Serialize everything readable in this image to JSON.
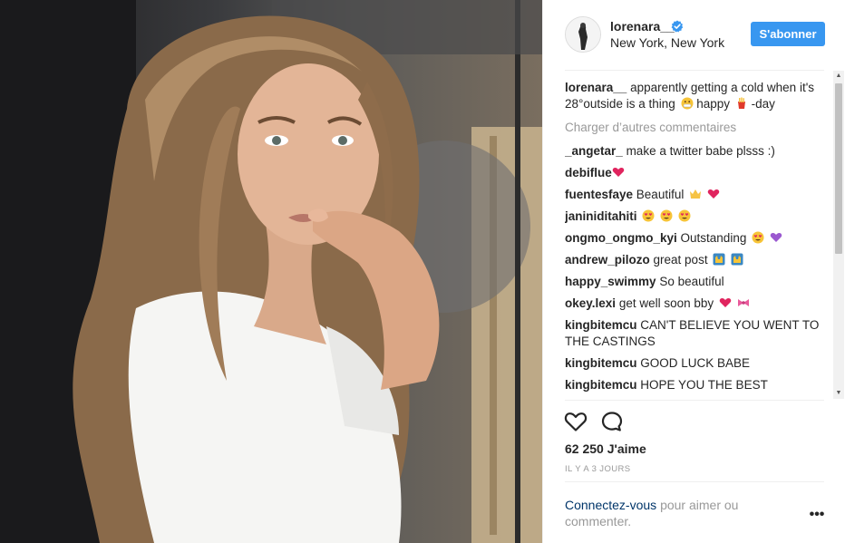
{
  "post": {
    "author": "lorenara__",
    "location": "New York, New York",
    "follow_label": "S'abonner",
    "caption_user": "lorenara__",
    "caption_text_1": "apparently getting a cold when it's 28°outside is a thing",
    "caption_text_2": "happy",
    "caption_text_3": "-day",
    "load_more_label": "Charger d’autres commentaires",
    "comments": [
      {
        "user": "_angetar_",
        "text": "make a twitter babe plsss :)"
      },
      {
        "user": "debiflue",
        "text": ""
      },
      {
        "user": "fuentesfaye",
        "text": "Beautiful"
      },
      {
        "user": "janiniditahiti",
        "text": ""
      },
      {
        "user": "ongmo_ongmo_kyi",
        "text": "Outstanding"
      },
      {
        "user": "andrew_pilozo",
        "text": "great post"
      },
      {
        "user": "happy_swimmy",
        "text": "So beautiful"
      },
      {
        "user": "okey.lexi",
        "text": "get well soon bby"
      },
      {
        "user": "kingbitemcu",
        "text": "CAN'T BELIEVE YOU WENT TO THE CASTINGS"
      },
      {
        "user": "kingbitemcu",
        "text": "GOOD LUCK BABE"
      },
      {
        "user": "kingbitemcu",
        "text": "HOPE YOU THE BEST"
      }
    ],
    "likes_label": "62 250 J'aime",
    "time_label": "IL Y A 3 JOURS",
    "login_link": "Connectez-vous",
    "login_rest": "pour aimer ou commenter.",
    "more_label": "•••"
  },
  "icons": {
    "verified": "verified-badge-icon",
    "like": "heart-outline-icon",
    "comment": "speech-bubble-icon",
    "more": "ellipsis-icon"
  },
  "colors": {
    "accent": "#3897f0",
    "text": "#262626",
    "muted": "#999999",
    "link": "#003569"
  }
}
